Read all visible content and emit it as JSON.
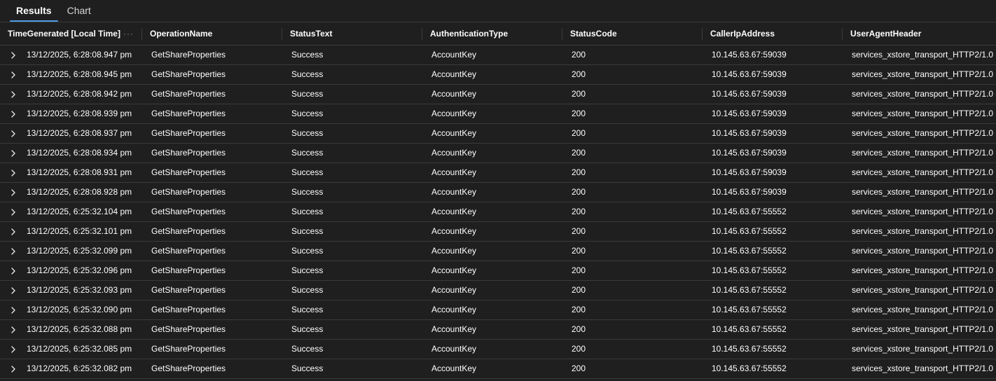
{
  "tabs": [
    {
      "label": "Results",
      "active": true
    },
    {
      "label": "Chart",
      "active": false
    }
  ],
  "columns": [
    "TimeGenerated [Local Time]",
    "OperationName",
    "StatusText",
    "AuthenticationType",
    "StatusCode",
    "CallerIpAddress",
    "UserAgentHeader"
  ],
  "header_menu_icon": "ellipsis-icon",
  "row_expander_icon": "chevron-right-icon",
  "accent_color": "#4f9be8",
  "rows": [
    [
      "13/12/2025, 6:28:08.947 pm",
      "GetShareProperties",
      "Success",
      "AccountKey",
      "200",
      "10.145.63.67:59039",
      "services_xstore_transport_HTTP2/1.0"
    ],
    [
      "13/12/2025, 6:28:08.945 pm",
      "GetShareProperties",
      "Success",
      "AccountKey",
      "200",
      "10.145.63.67:59039",
      "services_xstore_transport_HTTP2/1.0"
    ],
    [
      "13/12/2025, 6:28:08.942 pm",
      "GetShareProperties",
      "Success",
      "AccountKey",
      "200",
      "10.145.63.67:59039",
      "services_xstore_transport_HTTP2/1.0"
    ],
    [
      "13/12/2025, 6:28:08.939 pm",
      "GetShareProperties",
      "Success",
      "AccountKey",
      "200",
      "10.145.63.67:59039",
      "services_xstore_transport_HTTP2/1.0"
    ],
    [
      "13/12/2025, 6:28:08.937 pm",
      "GetShareProperties",
      "Success",
      "AccountKey",
      "200",
      "10.145.63.67:59039",
      "services_xstore_transport_HTTP2/1.0"
    ],
    [
      "13/12/2025, 6:28:08.934 pm",
      "GetShareProperties",
      "Success",
      "AccountKey",
      "200",
      "10.145.63.67:59039",
      "services_xstore_transport_HTTP2/1.0"
    ],
    [
      "13/12/2025, 6:28:08.931 pm",
      "GetShareProperties",
      "Success",
      "AccountKey",
      "200",
      "10.145.63.67:59039",
      "services_xstore_transport_HTTP2/1.0"
    ],
    [
      "13/12/2025, 6:28:08.928 pm",
      "GetShareProperties",
      "Success",
      "AccountKey",
      "200",
      "10.145.63.67:59039",
      "services_xstore_transport_HTTP2/1.0"
    ],
    [
      "13/12/2025, 6:25:32.104 pm",
      "GetShareProperties",
      "Success",
      "AccountKey",
      "200",
      "10.145.63.67:55552",
      "services_xstore_transport_HTTP2/1.0"
    ],
    [
      "13/12/2025, 6:25:32.101 pm",
      "GetShareProperties",
      "Success",
      "AccountKey",
      "200",
      "10.145.63.67:55552",
      "services_xstore_transport_HTTP2/1.0"
    ],
    [
      "13/12/2025, 6:25:32.099 pm",
      "GetShareProperties",
      "Success",
      "AccountKey",
      "200",
      "10.145.63.67:55552",
      "services_xstore_transport_HTTP2/1.0"
    ],
    [
      "13/12/2025, 6:25:32.096 pm",
      "GetShareProperties",
      "Success",
      "AccountKey",
      "200",
      "10.145.63.67:55552",
      "services_xstore_transport_HTTP2/1.0"
    ],
    [
      "13/12/2025, 6:25:32.093 pm",
      "GetShareProperties",
      "Success",
      "AccountKey",
      "200",
      "10.145.63.67:55552",
      "services_xstore_transport_HTTP2/1.0"
    ],
    [
      "13/12/2025, 6:25:32.090 pm",
      "GetShareProperties",
      "Success",
      "AccountKey",
      "200",
      "10.145.63.67:55552",
      "services_xstore_transport_HTTP2/1.0"
    ],
    [
      "13/12/2025, 6:25:32.088 pm",
      "GetShareProperties",
      "Success",
      "AccountKey",
      "200",
      "10.145.63.67:55552",
      "services_xstore_transport_HTTP2/1.0"
    ],
    [
      "13/12/2025, 6:25:32.085 pm",
      "GetShareProperties",
      "Success",
      "AccountKey",
      "200",
      "10.145.63.67:55552",
      "services_xstore_transport_HTTP2/1.0"
    ],
    [
      "13/12/2025, 6:25:32.082 pm",
      "GetShareProperties",
      "Success",
      "AccountKey",
      "200",
      "10.145.63.67:55552",
      "services_xstore_transport_HTTP2/1.0"
    ]
  ]
}
